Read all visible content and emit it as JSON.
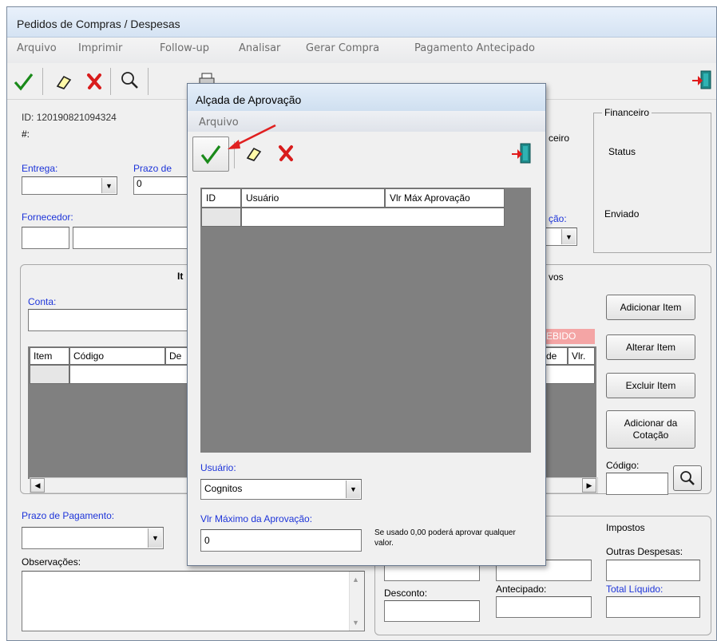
{
  "window": {
    "title": "Pedidos de Compras / Despesas"
  },
  "menu": [
    "Arquivo",
    "Imprimir",
    "Follow-up",
    "Analisar",
    "Gerar Compra",
    "Pagamento Antecipado"
  ],
  "header": {
    "id_label": "ID:",
    "id_value": "120190821094324",
    "hash_label": "#:",
    "entrega_label": "Entrega:",
    "prazo_label": "Prazo de",
    "prazo_value": "0",
    "fornecedor_label": "Fornecedor:",
    "ceiro_text": "ceiro",
    "cao_label": "ção:"
  },
  "status_group": {
    "financeiro_label": "Financeiro",
    "status_label": "Status",
    "enviado_label": "Enviado"
  },
  "items_group": {
    "title_fragment": "It",
    "vos_fragment": "vos",
    "conta_label": "Conta:",
    "columns": [
      "Item",
      "Código",
      "De"
    ],
    "right_columns": [
      "de",
      "Vlr."
    ],
    "recebido_fragment": "EBIDO",
    "buttons": {
      "add": "Adicionar Item",
      "alter": "Alterar Item",
      "delete": "Excluir Item",
      "add_quote": "Adicionar da Cotação"
    },
    "codigo_label": "Código:"
  },
  "footer": {
    "prazo_pagamento_label": "Prazo de Pagamento:",
    "observacoes_label": "Observações:",
    "impostos_label": "Impostos",
    "outras_despesas_label": "Outras Despesas:",
    "desconto_label": "Desconto:",
    "antecipado_label": "Antecipado:",
    "total_liquido_label": "Total Líquido:"
  },
  "dialog": {
    "title": "Alçada de Aprovação",
    "menu": [
      "Arquivo"
    ],
    "columns": [
      "ID",
      "Usuário",
      "Vlr Máx Aprovação"
    ],
    "usuario_label": "Usuário:",
    "usuario_value": "Cognitos",
    "vlr_label": "Vlr Máximo da Aprovação:",
    "vlr_value": "0",
    "hint": "Se usado 0,00 poderá aprovar qualquer valor."
  },
  "colors": {
    "accent_blue": "#1d34d9",
    "recebido_bg": "#f4a5a5",
    "grid_dark": "#808080",
    "annotation_arrow": "#e02020"
  }
}
